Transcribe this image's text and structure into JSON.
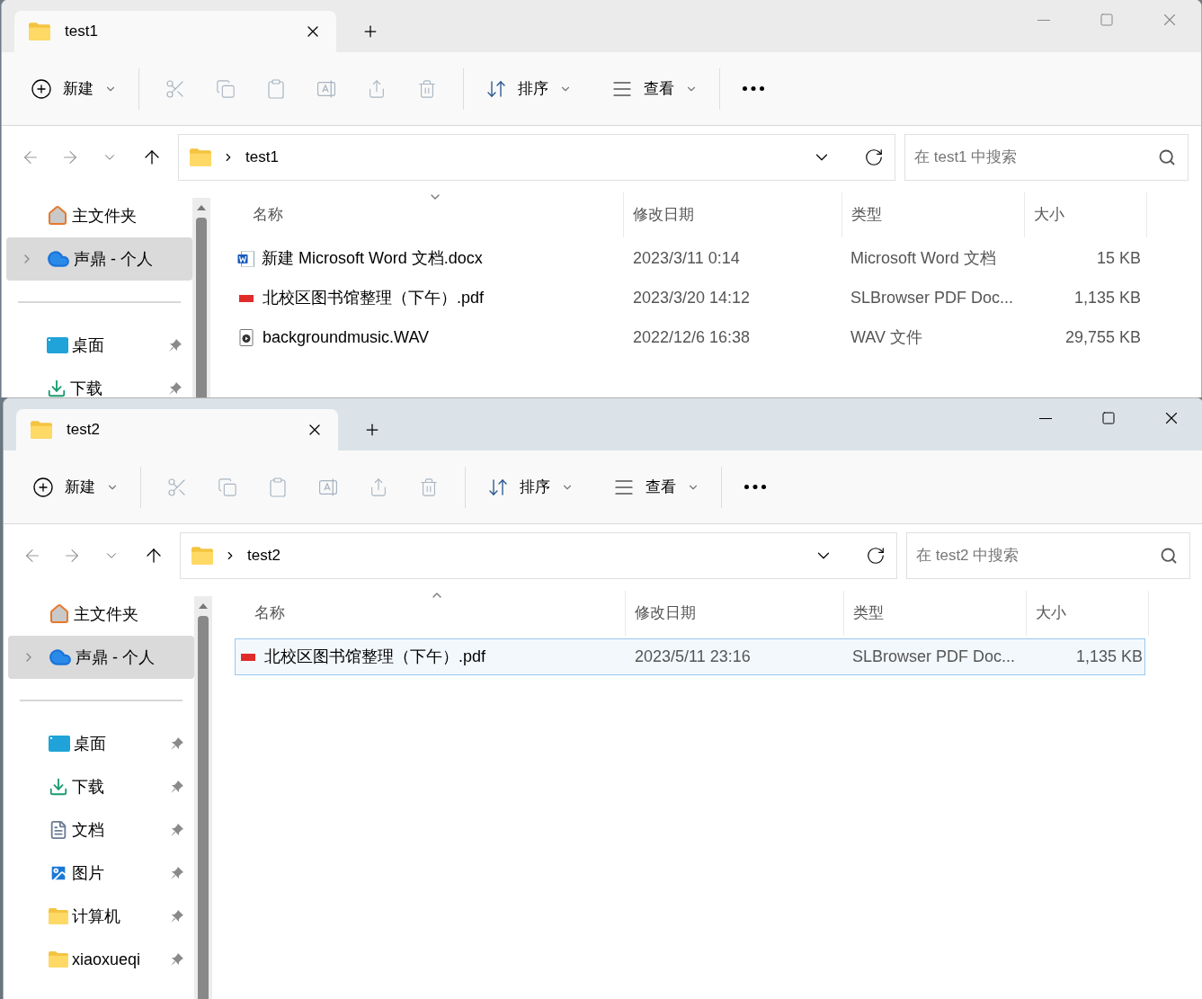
{
  "windows": [
    {
      "focused": false,
      "tab": {
        "title": "test1"
      },
      "toolbar": {
        "new": "新建",
        "sort": "排序",
        "view": "查看"
      },
      "address": {
        "path": "test1"
      },
      "search": {
        "placeholder": "在 test1 中搜索"
      },
      "sidebar": [
        {
          "kind": "home",
          "label": "主文件夹",
          "pinned": false,
          "selected": false
        },
        {
          "kind": "cloud",
          "label": "声鼎 - 个人",
          "pinned": false,
          "selected": true
        },
        {
          "kind": "desktop",
          "label": "桌面",
          "pinned": true,
          "selected": false
        },
        {
          "kind": "download",
          "label": "下载",
          "pinned": true,
          "selected": false
        }
      ],
      "columns": [
        {
          "label": "名称",
          "sort_ascending": false
        },
        {
          "label": "修改日期"
        },
        {
          "label": "类型"
        },
        {
          "label": "大小"
        }
      ],
      "rows": [
        {
          "kind": "word",
          "name": "新建 Microsoft Word 文档.docx",
          "date": "2023/3/11 0:14",
          "type": "Microsoft Word 文档",
          "size": "15 KB",
          "selected": false
        },
        {
          "kind": "pdf",
          "name": "北校区图书馆整理（下午）.pdf",
          "date": "2023/3/20 14:12",
          "type": "SLBrowser PDF Doc...",
          "size": "1,135 KB",
          "selected": false
        },
        {
          "kind": "audio",
          "name": "backgroundmusic.WAV",
          "date": "2022/12/6 16:38",
          "type": "WAV 文件",
          "size": "29,755 KB",
          "selected": false
        }
      ]
    },
    {
      "focused": true,
      "tab": {
        "title": "test2"
      },
      "toolbar": {
        "new": "新建",
        "sort": "排序",
        "view": "查看"
      },
      "address": {
        "path": "test2"
      },
      "search": {
        "placeholder": "在 test2 中搜索"
      },
      "sidebar": [
        {
          "kind": "home",
          "label": "主文件夹",
          "pinned": false,
          "selected": false
        },
        {
          "kind": "cloud",
          "label": "声鼎 - 个人",
          "pinned": false,
          "selected": true
        },
        {
          "kind": "desktop",
          "label": "桌面",
          "pinned": true,
          "selected": false
        },
        {
          "kind": "download",
          "label": "下载",
          "pinned": true,
          "selected": false
        },
        {
          "kind": "documents",
          "label": "文档",
          "pinned": true,
          "selected": false
        },
        {
          "kind": "pictures",
          "label": "图片",
          "pinned": true,
          "selected": false
        },
        {
          "kind": "folder",
          "label": "计算机",
          "pinned": true,
          "selected": false
        },
        {
          "kind": "folder",
          "label": "xiaoxueqi",
          "pinned": true,
          "selected": false
        }
      ],
      "columns": [
        {
          "label": "名称",
          "sort_ascending": true
        },
        {
          "label": "修改日期"
        },
        {
          "label": "类型"
        },
        {
          "label": "大小"
        }
      ],
      "rows": [
        {
          "kind": "pdf",
          "name": "北校区图书馆整理（下午）.pdf",
          "date": "2023/5/11 23:16",
          "type": "SLBrowser PDF Doc...",
          "size": "1,135 KB",
          "selected": true
        }
      ]
    }
  ]
}
